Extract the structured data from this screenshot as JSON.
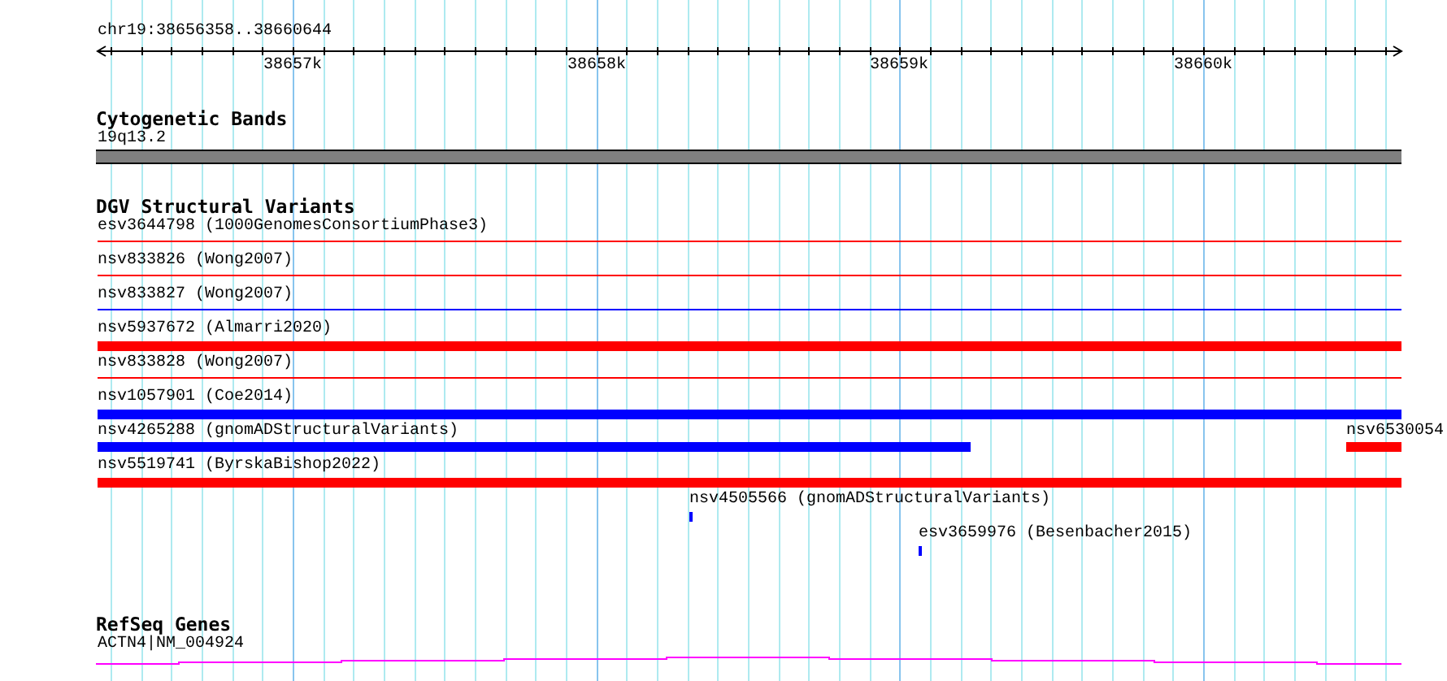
{
  "ruler": {
    "location": "chr19:38656358..38660644",
    "tick_labels": [
      "38657k",
      "38658k",
      "38659k",
      "38660k"
    ]
  },
  "tracks": [
    {
      "title": "Cytogenetic Bands",
      "kind": "bands",
      "features": [
        {
          "label": "19q13.2"
        }
      ]
    },
    {
      "title": "DGV Structural Variants",
      "kind": "variants",
      "features": [
        {
          "label": "esv3644798 (1000GenomesConsortiumPhase3)",
          "kind": "thin",
          "color": "#ff0000"
        },
        {
          "label": "nsv833826 (Wong2007)",
          "kind": "thin",
          "color": "#ff0000"
        },
        {
          "label": "nsv833827 (Wong2007)",
          "kind": "thin",
          "color": "#0000ff"
        },
        {
          "label": "nsv5937672 (Almarri2020)",
          "kind": "thick",
          "color": "#ff0000"
        },
        {
          "label": "nsv833828 (Wong2007)",
          "kind": "thin",
          "color": "#ff0000"
        },
        {
          "label": "nsv1057901 (Coe2014)",
          "kind": "thick",
          "color": "#0000ff"
        },
        {
          "label": "nsv4265288 (gnomADStructuralVariants)",
          "kind": "thick",
          "color": "#0000ff"
        },
        {
          "label": "nsv6530054",
          "kind": "thick",
          "color": "#ff0000"
        },
        {
          "label": "nsv5519741 (ByrskaBishop2022)",
          "kind": "thick",
          "color": "#ff0000"
        },
        {
          "label": "nsv4505566 (gnomADStructuralVariants)",
          "kind": "tick",
          "color": "#0000ff"
        },
        {
          "label": "esv3659976 (Besenbacher2015)",
          "kind": "tick",
          "color": "#0000ff"
        }
      ]
    },
    {
      "title": "RefSeq Genes",
      "kind": "genes",
      "features": [
        {
          "label": "ACTN4|NM_004924"
        }
      ]
    }
  ]
}
